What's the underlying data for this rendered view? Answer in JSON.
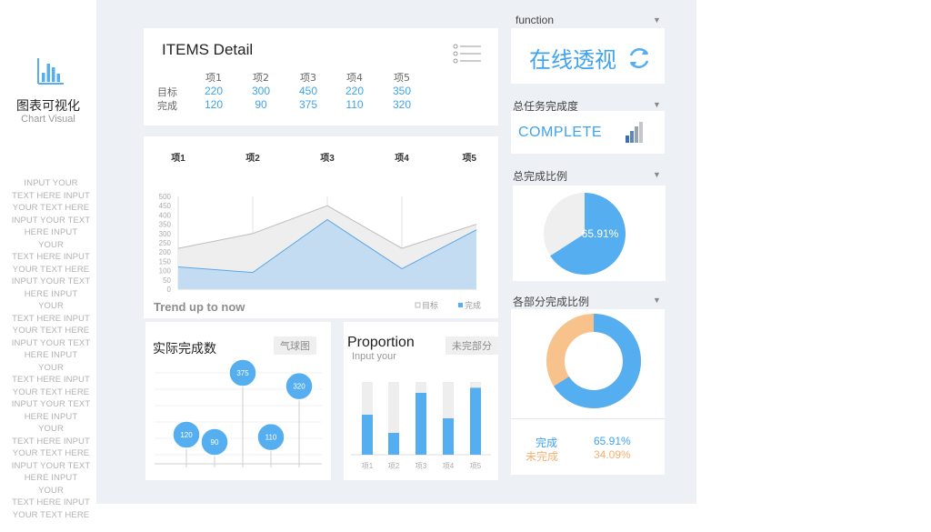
{
  "sidebar": {
    "icon": "bar-chart-icon",
    "title": "图表可视化",
    "subtitle": "Chart Visual",
    "placeholder_lines": [
      "INPUT YOUR",
      "TEXT HERE INPUT",
      "YOUR TEXT HERE",
      "INPUT YOUR TEXT",
      "HERE INPUT YOUR",
      "TEXT HERE INPUT",
      "YOUR TEXT HERE",
      "INPUT YOUR TEXT",
      "HERE INPUT YOUR",
      "TEXT HERE INPUT",
      "YOUR TEXT HERE",
      "INPUT YOUR TEXT",
      "HERE INPUT YOUR",
      "TEXT HERE INPUT",
      "YOUR TEXT HERE",
      "INPUT YOUR TEXT",
      "HERE INPUT YOUR",
      "TEXT HERE INPUT",
      "YOUR TEXT HERE",
      "INPUT YOUR TEXT",
      "HERE INPUT YOUR",
      "TEXT HERE INPUT",
      "YOUR TEXT HERE"
    ]
  },
  "colors": {
    "blue": "#55aef0",
    "blue_text": "#3fa3ee",
    "orange": "#f8c28c",
    "gray_fill": "#eeeeee",
    "panel_bg": "#edf0f5"
  },
  "items_detail": {
    "title": "ITEMS Detail",
    "icon": "list-menu-icon",
    "headers": [
      "项1",
      "项2",
      "项3",
      "项4",
      "项5"
    ],
    "rows": [
      {
        "label": "目标",
        "values": [
          "220",
          "300",
          "450",
          "220",
          "350"
        ]
      },
      {
        "label": "完成",
        "values": [
          "120",
          "90",
          "375",
          "110",
          "320"
        ]
      }
    ]
  },
  "function_panel": {
    "label": "function",
    "text": "在线透视",
    "icon": "refresh-icon"
  },
  "completion_panel": {
    "label": "总任务完成度",
    "text": "COMPLETE",
    "icon": "signal-bars-icon"
  },
  "pie_panel": {
    "label": "总完成比例"
  },
  "donut_panel": {
    "label": "各部分完成比例",
    "legend": [
      {
        "name": "完成",
        "value": "65.91%",
        "color": "#3fa3ee"
      },
      {
        "name": "未完成",
        "value": "34.09%",
        "color": "#f5b072"
      }
    ]
  },
  "balloon_panel": {
    "title": "实际完成数",
    "tag": "气球图"
  },
  "proportion_panel": {
    "title": "Proportion",
    "subtitle": "Input your",
    "tag": "未完部分"
  },
  "chart_data": [
    {
      "type": "area",
      "title": "Trend up to now",
      "categories": [
        "项1",
        "项2",
        "项3",
        "项4",
        "项5"
      ],
      "yticks": [
        "0",
        "50",
        "100",
        "150",
        "200",
        "250",
        "300",
        "350",
        "400",
        "450",
        "500"
      ],
      "ylim": [
        0,
        500
      ],
      "legend": [
        "目标",
        "完成"
      ],
      "series": [
        {
          "name": "目标",
          "values": [
            220,
            300,
            450,
            220,
            350
          ],
          "color": "#eeeeee"
        },
        {
          "name": "完成",
          "values": [
            120,
            90,
            375,
            110,
            320
          ],
          "color": "#c1dcf2"
        }
      ]
    },
    {
      "type": "scatter",
      "title": "实际完成数",
      "categories": [
        "项1",
        "项2",
        "项3",
        "项4",
        "项5"
      ],
      "values": [
        120,
        90,
        375,
        110,
        320
      ],
      "labels": [
        "120",
        "90",
        "375",
        "110",
        "320"
      ],
      "ylim": [
        0,
        450
      ]
    },
    {
      "type": "bar",
      "title": "Proportion",
      "categories": [
        "项1",
        "项2",
        "项3",
        "项4",
        "项5"
      ],
      "series": [
        {
          "name": "完成",
          "values": [
            0.55,
            0.3,
            0.85,
            0.5,
            0.92
          ]
        },
        {
          "name": "未完部分",
          "values": [
            0.45,
            0.7,
            0.15,
            0.5,
            0.08
          ]
        }
      ]
    },
    {
      "type": "pie",
      "title": "总完成比例",
      "slices": [
        {
          "name": "完成",
          "value": 65.91
        },
        {
          "name": "未完成",
          "value": 34.09
        }
      ],
      "label": "65.91%"
    },
    {
      "type": "pie",
      "title": "各部分完成比例",
      "donut": true,
      "slices": [
        {
          "name": "完成",
          "value": 65.91
        },
        {
          "name": "未完成",
          "value": 34.09
        }
      ]
    }
  ]
}
